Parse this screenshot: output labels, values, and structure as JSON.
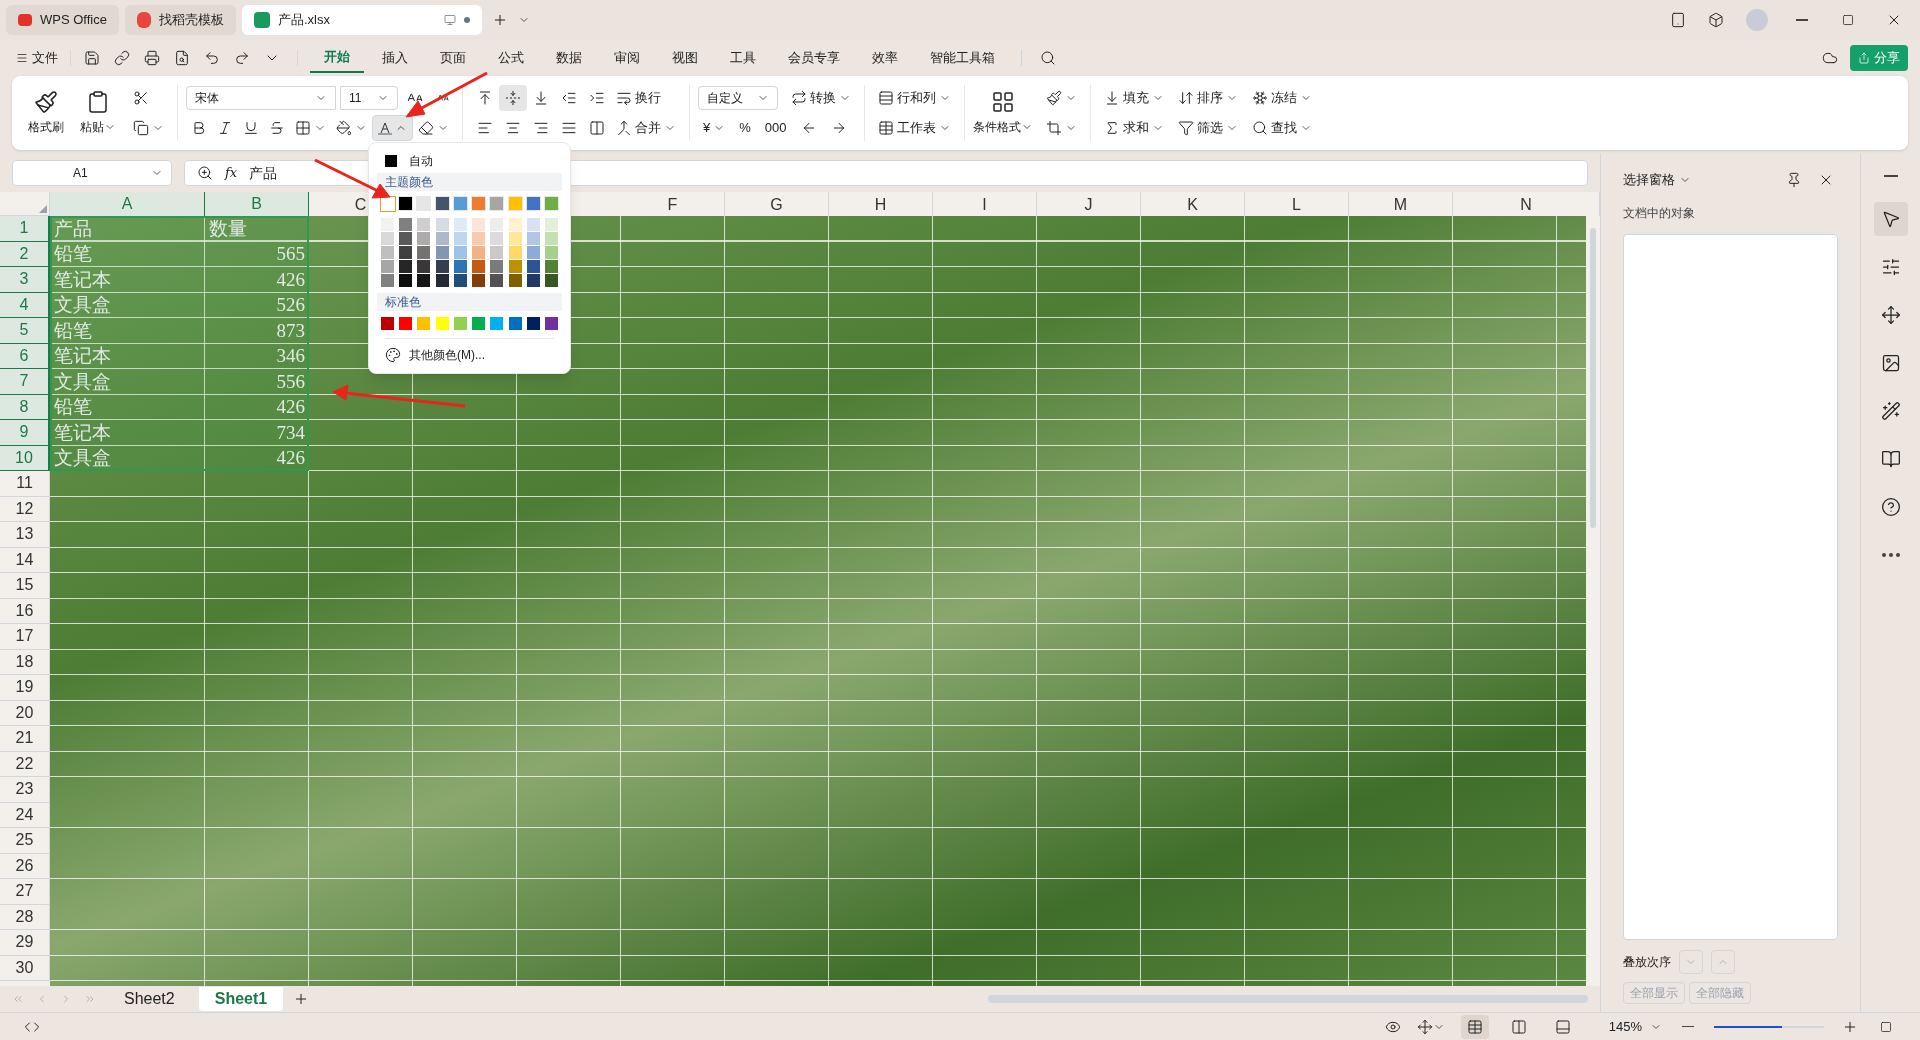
{
  "window_tabs": [
    {
      "label": "WPS Office",
      "kind": "wps",
      "selected": false
    },
    {
      "label": "找稻壳模板",
      "kind": "docer",
      "selected": false
    },
    {
      "label": "产品.xlsx",
      "kind": "sheet",
      "selected": true
    }
  ],
  "menu": {
    "file": "文件",
    "tabs": [
      {
        "label": "开始",
        "selected": true
      },
      {
        "label": "插入",
        "selected": false
      },
      {
        "label": "页面",
        "selected": false
      },
      {
        "label": "公式",
        "selected": false
      },
      {
        "label": "数据",
        "selected": false
      },
      {
        "label": "审阅",
        "selected": false
      },
      {
        "label": "视图",
        "selected": false
      },
      {
        "label": "工具",
        "selected": false
      },
      {
        "label": "会员专享",
        "selected": false
      },
      {
        "label": "效率",
        "selected": false
      },
      {
        "label": "智能工具箱",
        "selected": false
      }
    ],
    "share": "分享"
  },
  "ribbon": {
    "paint": "格式刷",
    "paste": "粘贴",
    "font_name": "宋体",
    "font_size": "11",
    "font_color_open": true,
    "align_buttons": [
      {
        "kind": "top",
        "selected": false
      },
      {
        "kind": "middle",
        "selected": true
      },
      {
        "kind": "bottom",
        "selected": false
      },
      {
        "kind": "outdent",
        "selected": false
      },
      {
        "kind": "indent",
        "selected": false
      }
    ],
    "wrap": "换行",
    "merge": "合并",
    "number_format": "自定义",
    "convert": "转换",
    "currency": "¥",
    "percent": "%",
    "thousands": "000",
    "rows_cols": "行和列",
    "worksheet": "工作表",
    "cond_format": "条件格式",
    "tools": [
      {
        "label": "填充",
        "kind": "fill"
      },
      {
        "label": "排序",
        "kind": "sort"
      },
      {
        "label": "冻结",
        "kind": "freeze"
      },
      {
        "label": "求和",
        "kind": "sum"
      },
      {
        "label": "筛选",
        "kind": "filter"
      },
      {
        "label": "查找",
        "kind": "find"
      }
    ]
  },
  "formula_bar": {
    "cell_ref": "A1",
    "function_label": "fx",
    "content": "产品"
  },
  "sheet": {
    "columns": [
      {
        "label": "A",
        "selected": true
      },
      {
        "label": "B",
        "selected": true
      },
      {
        "label": "C",
        "selected": false
      },
      {
        "kind": "covered"
      },
      {
        "kind": "covered"
      },
      {
        "label": "F",
        "selected": false
      },
      {
        "label": "G",
        "selected": false
      },
      {
        "label": "H",
        "selected": false
      },
      {
        "label": "I",
        "selected": false
      },
      {
        "label": "J",
        "selected": false
      },
      {
        "label": "K",
        "selected": false
      },
      {
        "label": "L",
        "selected": false
      },
      {
        "label": "M",
        "selected": false
      },
      {
        "label": "N",
        "selected": false
      }
    ],
    "rows": [
      {
        "label": "1",
        "selected": true
      },
      {
        "label": "2",
        "selected": true
      },
      {
        "label": "3",
        "selected": true
      },
      {
        "label": "4",
        "selected": true
      },
      {
        "label": "5",
        "selected": true
      },
      {
        "label": "6",
        "selected": true
      },
      {
        "label": "7",
        "selected": true
      },
      {
        "label": "8",
        "selected": true
      },
      {
        "label": "9",
        "selected": true
      },
      {
        "label": "10",
        "selected": true
      },
      {
        "label": "11",
        "selected": false
      },
      {
        "label": "12",
        "selected": false
      },
      {
        "label": "13",
        "selected": false
      },
      {
        "label": "14",
        "selected": false
      },
      {
        "label": "15",
        "selected": false
      },
      {
        "label": "16",
        "selected": false
      },
      {
        "label": "17",
        "selected": false
      },
      {
        "label": "18",
        "selected": false
      },
      {
        "label": "19",
        "selected": false
      },
      {
        "label": "20",
        "selected": false
      },
      {
        "label": "21",
        "selected": false
      },
      {
        "label": "22",
        "selected": false
      },
      {
        "label": "23",
        "selected": false
      },
      {
        "label": "24",
        "selected": false
      },
      {
        "label": "25",
        "selected": false
      },
      {
        "label": "26",
        "selected": false
      },
      {
        "label": "27",
        "selected": false
      },
      {
        "label": "28",
        "selected": false
      },
      {
        "label": "29",
        "selected": false
      },
      {
        "label": "30",
        "selected": false
      }
    ],
    "cells": [
      [
        "产品",
        "数量"
      ],
      [
        "铅笔",
        "565"
      ],
      [
        "笔记本",
        "426"
      ],
      [
        "文具盒",
        "526"
      ],
      [
        "铅笔",
        "873"
      ],
      [
        "笔记本",
        "346"
      ],
      [
        "文具盒",
        "556"
      ],
      [
        "铅笔",
        "426"
      ],
      [
        "笔记本",
        "734"
      ],
      [
        "文具盒",
        "426"
      ]
    ]
  },
  "color_menu": {
    "auto": "自动",
    "theme_heading": "主题颜色",
    "theme": [
      {
        "color": "#ffffff",
        "selected": true
      },
      {
        "color": "#000000",
        "selected": false
      },
      {
        "color": "#e7e6e6",
        "selected": false
      },
      {
        "color": "#44546a",
        "selected": false
      },
      {
        "color": "#5b9bd5",
        "selected": false
      },
      {
        "color": "#ed7d31",
        "selected": false
      },
      {
        "color": "#a5a5a5",
        "selected": false
      },
      {
        "color": "#ffc000",
        "selected": false
      },
      {
        "color": "#4472c4",
        "selected": false
      },
      {
        "color": "#70ad47",
        "selected": false
      }
    ],
    "shades": [
      {
        "swatches": [
          {
            "color": "#f2f2f2"
          },
          {
            "color": "#808080"
          },
          {
            "color": "#d0cece"
          },
          {
            "color": "#d6dce4"
          },
          {
            "color": "#deebf6"
          },
          {
            "color": "#fbe5d5"
          },
          {
            "color": "#ededed"
          },
          {
            "color": "#fff2cc"
          },
          {
            "color": "#d9e2f3"
          },
          {
            "color": "#e2efd9"
          }
        ]
      },
      {
        "swatches": [
          {
            "color": "#d9d9d9"
          },
          {
            "color": "#595959"
          },
          {
            "color": "#aeabab"
          },
          {
            "color": "#adb9ca"
          },
          {
            "color": "#bdd7ee"
          },
          {
            "color": "#f8cbad"
          },
          {
            "color": "#dbdbdb"
          },
          {
            "color": "#ffe699"
          },
          {
            "color": "#b4c6e7"
          },
          {
            "color": "#c5e0b3"
          }
        ]
      },
      {
        "swatches": [
          {
            "color": "#bfbfbf"
          },
          {
            "color": "#404040"
          },
          {
            "color": "#767171"
          },
          {
            "color": "#8497b0"
          },
          {
            "color": "#9dc3e6"
          },
          {
            "color": "#f4b183"
          },
          {
            "color": "#c9c9c9"
          },
          {
            "color": "#ffd966"
          },
          {
            "color": "#8eaadb"
          },
          {
            "color": "#a8d08d"
          }
        ]
      },
      {
        "swatches": [
          {
            "color": "#a6a6a6"
          },
          {
            "color": "#262626"
          },
          {
            "color": "#3a3838"
          },
          {
            "color": "#333f4f"
          },
          {
            "color": "#2e75b5"
          },
          {
            "color": "#c55a11"
          },
          {
            "color": "#7b7b7b"
          },
          {
            "color": "#bf9000"
          },
          {
            "color": "#2f5496"
          },
          {
            "color": "#538135"
          }
        ]
      },
      {
        "swatches": [
          {
            "color": "#808080"
          },
          {
            "color": "#0d0d0d"
          },
          {
            "color": "#171616"
          },
          {
            "color": "#222a35"
          },
          {
            "color": "#1f4e79"
          },
          {
            "color": "#843c0b"
          },
          {
            "color": "#525252"
          },
          {
            "color": "#7f6000"
          },
          {
            "color": "#1f3864"
          },
          {
            "color": "#375623"
          }
        ]
      }
    ],
    "standard_heading": "标准色",
    "standard": [
      {
        "color": "#c00000"
      },
      {
        "color": "#ff0000"
      },
      {
        "color": "#ffc000"
      },
      {
        "color": "#ffff00"
      },
      {
        "color": "#92d050"
      },
      {
        "color": "#00b050"
      },
      {
        "color": "#00b0f0"
      },
      {
        "color": "#0070c0"
      },
      {
        "color": "#002060"
      },
      {
        "color": "#7030a0"
      }
    ],
    "more": "其他颜色(M)..."
  },
  "sheet_tabs": [
    {
      "label": "Sheet2",
      "selected": false
    },
    {
      "label": "Sheet1",
      "selected": true
    }
  ],
  "selection_pane": {
    "title": "选择窗格",
    "subtitle": "文档中的对象",
    "order_label": "叠放次序",
    "show_all": "全部显示",
    "hide_all": "全部隐藏"
  },
  "status_bar": {
    "zoom": "145%",
    "zoom_slider": {
      "level": 0.62
    }
  }
}
